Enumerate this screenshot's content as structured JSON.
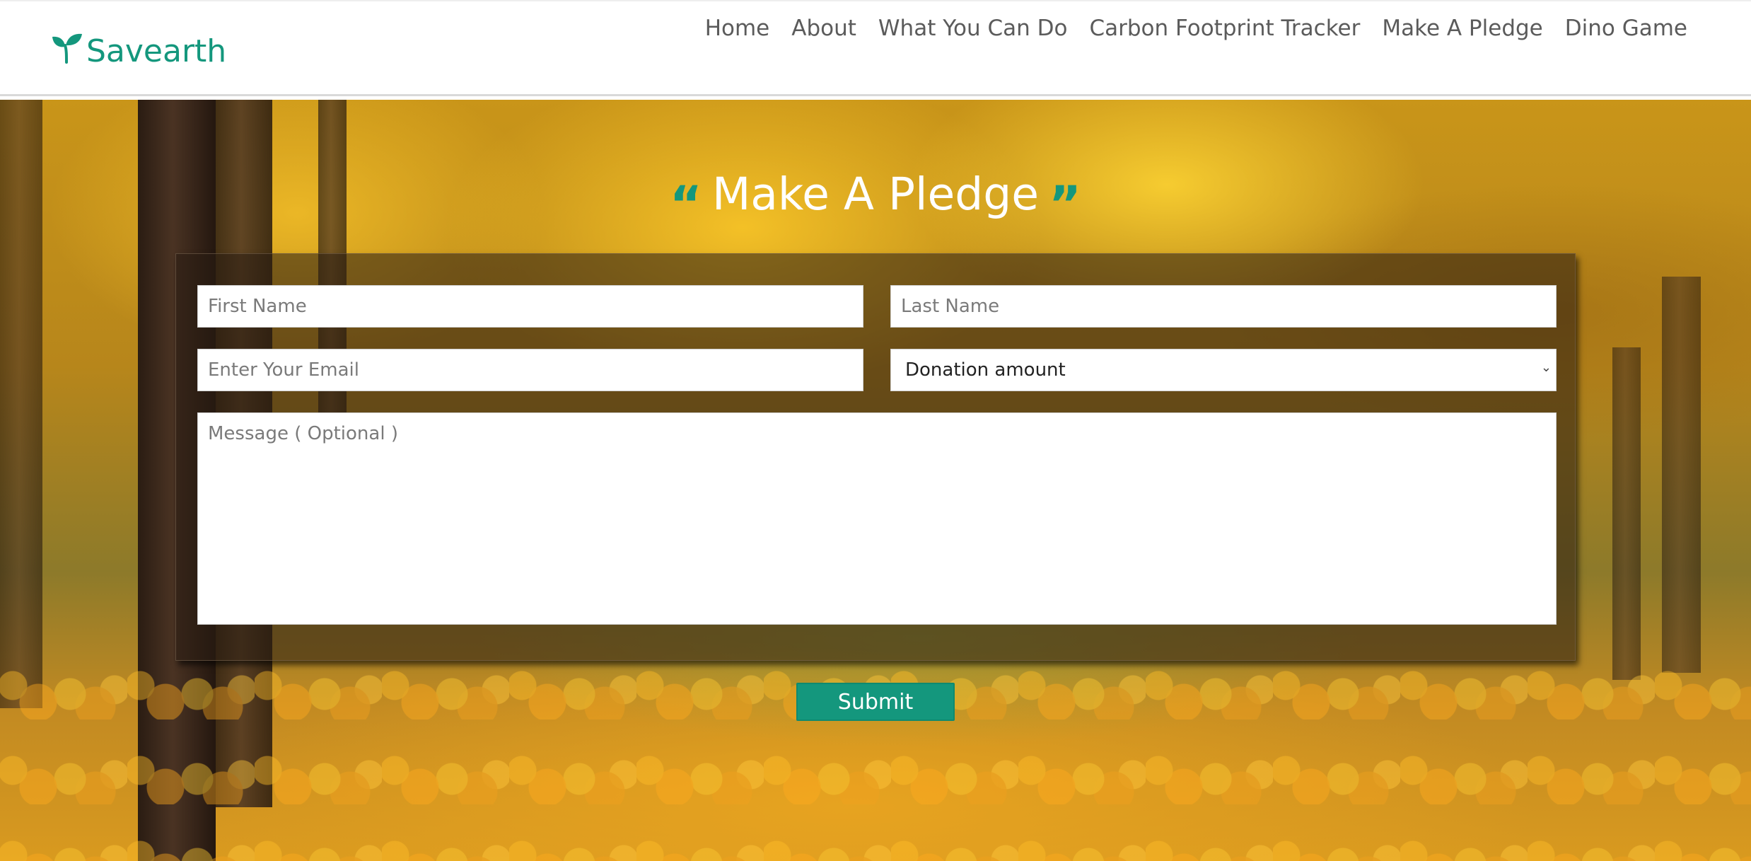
{
  "brand": {
    "name": "Savearth",
    "icon": "sprout-icon",
    "color": "#14977d"
  },
  "nav": {
    "items": [
      {
        "label": "Home"
      },
      {
        "label": "About"
      },
      {
        "label": "What You Can Do"
      },
      {
        "label": "Carbon Footprint Tracker"
      },
      {
        "label": "Make A Pledge"
      },
      {
        "label": "Dino Game"
      }
    ]
  },
  "hero": {
    "title": "Make A Pledge",
    "open_quote": "“",
    "close_quote": "”",
    "background": "autumn forest with yellow leaves"
  },
  "form": {
    "first_name": {
      "placeholder": "First Name",
      "value": ""
    },
    "last_name": {
      "placeholder": "Last Name",
      "value": ""
    },
    "email": {
      "placeholder": "Enter Your Email",
      "value": ""
    },
    "donation": {
      "selected": "Donation amount"
    },
    "message": {
      "placeholder": "Message ( Optional )",
      "value": ""
    },
    "submit_label": "Submit"
  },
  "colors": {
    "accent": "#14977d",
    "nav_text": "#5b5b5b"
  }
}
